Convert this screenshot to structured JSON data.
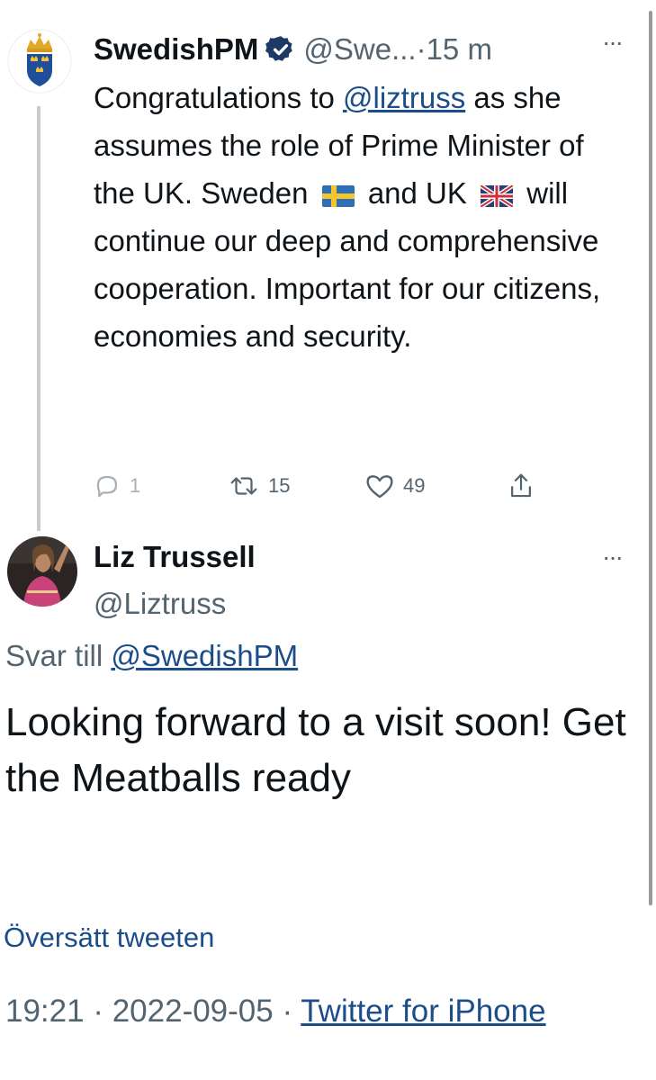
{
  "parent_tweet": {
    "display_name": "SwedishPM",
    "handle": "@Swe...",
    "time": "·15 m",
    "more": "···",
    "text_part1": "Congratulations to ",
    "mention": "@liztruss",
    "text_part2": " as she assumes the role of Prime Minister of the UK. Sweden ",
    "text_part3": " and UK ",
    "text_part4": " will continue our deep and comprehensive cooperation. Important for our citizens, economies and security.",
    "reply_count": "1",
    "retweet_count": "15",
    "like_count": "49"
  },
  "reply_tweet": {
    "display_name": "Liz Trussell",
    "handle": "@Liztruss",
    "more": "···",
    "replying_prefix": "Svar till ",
    "replying_to": "@SwedishPM",
    "text": "Looking forward to a visit soon! Get the Meatballs ready",
    "translate": "Översätt tweeten",
    "time": "19:21",
    "separator": " · ",
    "date": "2022-09-05",
    "source": "Twitter for iPhone"
  },
  "colors": {
    "text": "#0f1419",
    "secondary": "#536471",
    "link": "#1b4d8a",
    "verified": "#1d3a66",
    "thread_line": "#c9cdd1"
  }
}
